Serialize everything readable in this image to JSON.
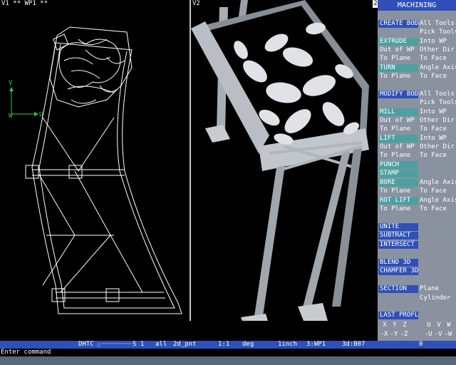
{
  "viewports": {
    "left_label": "V1 ** WP1 **",
    "right_label": "V2",
    "right_number": "2",
    "axis_v": "V",
    "axis_u": "U",
    "axis_w": "W"
  },
  "panel": {
    "title": "MACHINING",
    "create_bod": "CREATE BOD",
    "all_tools_1": "All Tools",
    "pick_tools_1": "Pick Tools",
    "extrude": "EXTRUDE",
    "into_wp_1": "Into WP",
    "out_of_wp_1": "Out of WP",
    "other_dir_1": "Other Dir",
    "to_plane_1": "To Plane",
    "to_face_1": "To Face",
    "turn": "TURN",
    "angle_axis_1": "Angle Axis",
    "to_plane_2": "To Plane",
    "to_face_2": "To Face",
    "modify_bod": "MODIFY BOD",
    "all_tools_2": "All Tools",
    "pick_tools_2": "Pick Tools",
    "mill": "MILL",
    "into_wp_2": "Into WP",
    "out_of_wp_2": "Out of WP",
    "other_dir_2": "Other Dir",
    "to_plane_3": "To Plane",
    "to_face_3": "To Face",
    "lift": "LIFT",
    "into_wp_3": "Into WP",
    "out_of_wp_3": "Out of WP",
    "other_dir_3": "Other Dir",
    "to_plane_4": "To Plane",
    "to_face_4": "To Face",
    "punch": "PUNCH",
    "stamp": "STAMP",
    "bore": "BORE",
    "angle_axis_2": "Angle Axis",
    "to_plane_5": "To Plane",
    "to_face_5": "To Face",
    "rot_lift": "ROT LIFT",
    "angle_axis_3": "Angle Axis",
    "to_plane_6": "To Plane",
    "to_face_6": "To Face",
    "unite": "UNITE",
    "subtract": "SUBTRACT",
    "intersect": "INTERSECT",
    "blend_3d": "BLEND 3D",
    "chamfer_3d": "CHAMFER 3D",
    "section": "SECTION",
    "plane": "Plane",
    "cylinder": "Cylinder",
    "last_profl": "LAST PROFL",
    "axes_row1": [
      "X",
      "Y",
      "Z",
      "U",
      "V",
      "W"
    ],
    "axes_row2": [
      "-X",
      "-Y",
      "-Z",
      "-U",
      "-V",
      "-W"
    ]
  },
  "status": {
    "dhtc": "DHTC",
    "s1": "S 1",
    "all": "all",
    "mode": "2d_pnt",
    "scale": "1:1",
    "angle_unit": "deg",
    "unit": "1inch",
    "wp": "3:WP1",
    "part": "3d:B07",
    "count": "0"
  },
  "command": {
    "prompt": "Enter command"
  },
  "colors": {
    "panel_bg": "#8a92a0",
    "blue": "#2f50b8",
    "teal": "#4ea0a0"
  }
}
